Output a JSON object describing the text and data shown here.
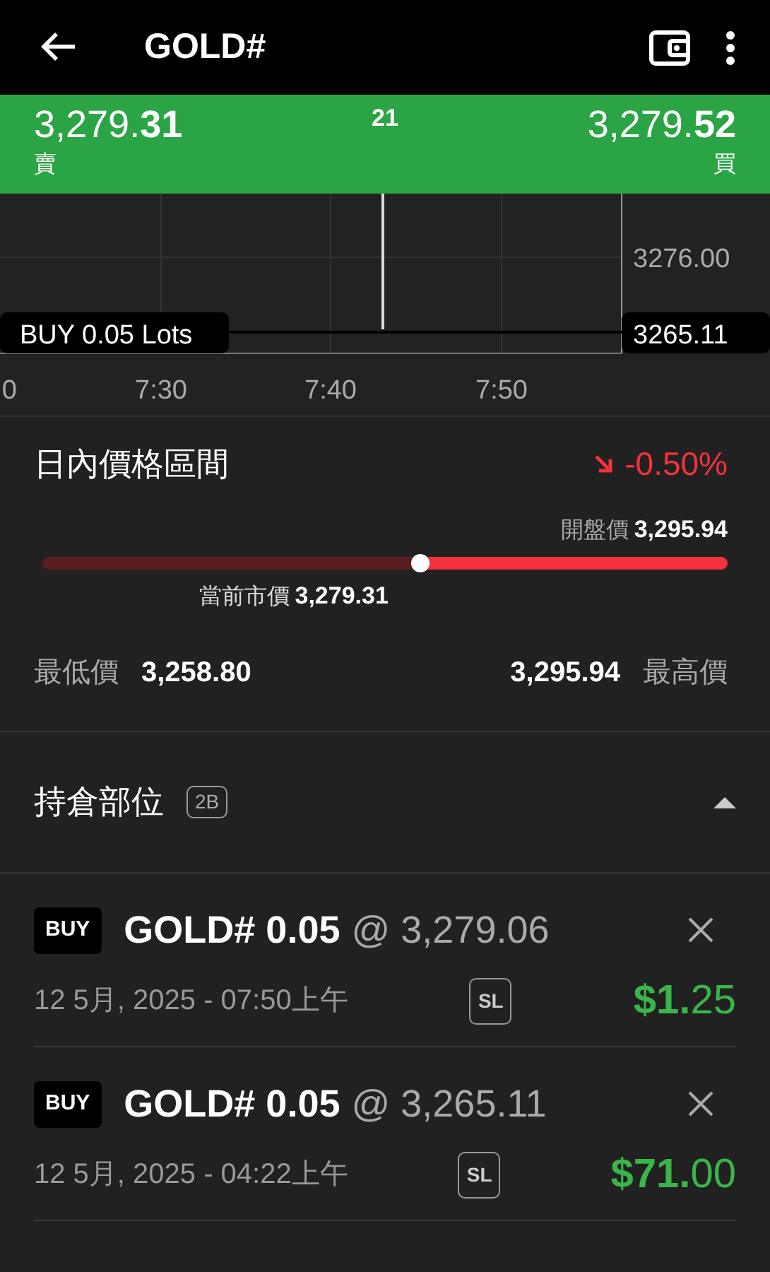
{
  "app_bar": {
    "title": "GOLD#"
  },
  "quote": {
    "bid": "3,279.**31**",
    "bid_label": "賣",
    "spread": "21",
    "ask": "3,279.**52**",
    "ask_label": "買"
  },
  "chart": {
    "x_labels": [
      "0",
      "7:30",
      "7:40",
      "7:50"
    ],
    "y_label": "3276.00",
    "order_label": "BUY 0.05 Lots",
    "order_price": "3265.11"
  },
  "day_range": {
    "title": "日內價格區間",
    "change": "-0.50%",
    "open_label": "開盤價",
    "open_value": "3,295.94",
    "level": 0.55,
    "current_label": "當前市價",
    "current_value": "3,279.31",
    "low_label": "最低價",
    "low_value": "3,258.80",
    "high_value": "3,295.94",
    "high_label": "最高價"
  },
  "positions": {
    "title": "持倉部位",
    "badge": "2B",
    "expanded": true,
    "items": [
      {
        "side": "BUY",
        "symbol": "GOLD# 0.05",
        "price": "@ 3,279.06",
        "time": "12 5月, 2025 - 07:50上午",
        "tag": "SL",
        "profit": "**$1.**25"
      },
      {
        "side": "BUY",
        "symbol": "GOLD# 0.05",
        "price": "@ 3,265.11",
        "time": "12 5月, 2025 - 04:22上午",
        "tag": "SL",
        "profit": "**$71.**00"
      }
    ]
  }
}
